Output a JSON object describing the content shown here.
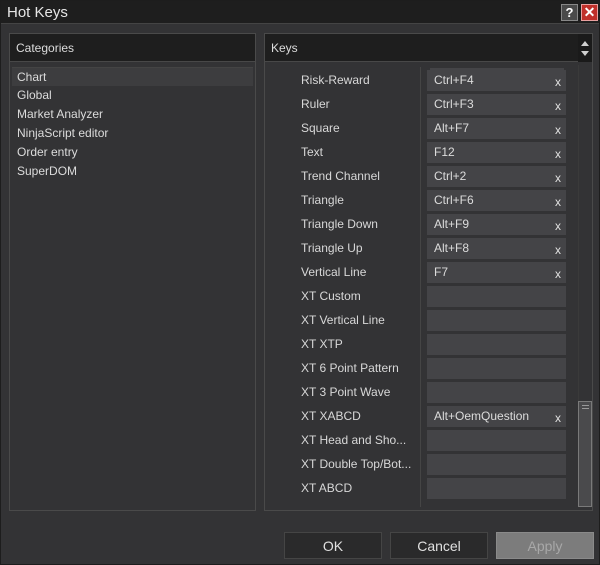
{
  "window": {
    "title": "Hot Keys",
    "help_label": "?",
    "close_label": "✕"
  },
  "categories": {
    "header": "Categories",
    "items": [
      {
        "label": "Chart",
        "selected": true
      },
      {
        "label": "Global"
      },
      {
        "label": "Market Analyzer"
      },
      {
        "label": "NinjaScript editor"
      },
      {
        "label": "Order entry"
      },
      {
        "label": "SuperDOM"
      }
    ]
  },
  "keys": {
    "header": "Keys",
    "clear_label": "x",
    "rows": [
      {
        "name": "Risk-Reward",
        "key": "Ctrl+F4"
      },
      {
        "name": "Ruler",
        "key": "Ctrl+F3"
      },
      {
        "name": "Square",
        "key": "Alt+F7"
      },
      {
        "name": "Text",
        "key": "F12"
      },
      {
        "name": "Trend Channel",
        "key": "Ctrl+2"
      },
      {
        "name": "Triangle",
        "key": "Ctrl+F6"
      },
      {
        "name": "Triangle Down",
        "key": "Alt+F9"
      },
      {
        "name": "Triangle Up",
        "key": "Alt+F8"
      },
      {
        "name": "Vertical Line",
        "key": "F7"
      },
      {
        "name": "XT Custom",
        "key": ""
      },
      {
        "name": "XT Vertical Line",
        "key": ""
      },
      {
        "name": "XT XTP",
        "key": ""
      },
      {
        "name": "XT 6 Point Pattern",
        "key": ""
      },
      {
        "name": "XT 3 Point Wave",
        "key": ""
      },
      {
        "name": "XT XABCD",
        "key": "Alt+OemQuestion"
      },
      {
        "name": "XT Head and Sho...",
        "key": ""
      },
      {
        "name": "XT Double Top/Bot...",
        "key": ""
      },
      {
        "name": "XT ABCD",
        "key": ""
      }
    ]
  },
  "buttons": {
    "ok": "OK",
    "cancel": "Cancel",
    "apply": "Apply"
  }
}
